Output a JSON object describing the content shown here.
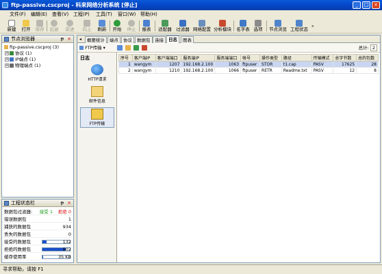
{
  "window": {
    "title": "ftp-passive.cscproj - 科来网络分析系统 [停止]"
  },
  "menu": [
    "文件(F)",
    "编辑(E)",
    "查看(V)",
    "工程(P)",
    "工具(T)",
    "窗口(W)",
    "帮助(H)"
  ],
  "toolbar": [
    {
      "label": "新建",
      "icon": "new-file-icon",
      "enabled": true
    },
    {
      "label": "打开",
      "icon": "open-folder-icon",
      "enabled": true
    },
    {
      "label": "保存",
      "icon": "save-icon",
      "enabled": false
    },
    {
      "label": "后退",
      "icon": "back-arrow-icon",
      "enabled": false
    },
    {
      "label": "前进",
      "icon": "forward-arrow-icon",
      "enabled": false
    },
    {
      "label": "向上",
      "icon": "up-icon",
      "enabled": false
    },
    {
      "label": "刷新",
      "icon": "refresh-icon",
      "enabled": true
    },
    {
      "label": "开始",
      "icon": "start-icon",
      "enabled": true
    },
    {
      "label": "停止",
      "icon": "stop-icon",
      "enabled": false
    },
    {
      "label": "报表",
      "icon": "report-icon",
      "enabled": true
    },
    {
      "label": "适配器",
      "icon": "adapter-icon",
      "enabled": true
    },
    {
      "label": "过滤器",
      "icon": "filter-icon",
      "enabled": true
    },
    {
      "label": "网络配置",
      "icon": "network-config-icon",
      "enabled": true
    },
    {
      "label": "分析模块",
      "icon": "analysis-module-icon",
      "enabled": true
    },
    {
      "label": "名字表",
      "icon": "name-table-icon",
      "enabled": true
    },
    {
      "label": "选项",
      "icon": "options-icon",
      "enabled": true
    },
    {
      "label": "节点浏览",
      "icon": "node-browser-icon",
      "enabled": true
    },
    {
      "label": "工程状态",
      "icon": "project-status-icon",
      "enabled": true
    }
  ],
  "node_panel": {
    "title": "节点浏览器",
    "root": "ftp-passive.cscproj (3)",
    "items": [
      "协议 (1)",
      "IP端点 (1)",
      "物理端点 (1)"
    ]
  },
  "status_panel": {
    "title": "工程状态栏",
    "filter_label": "数据包过滤器:",
    "accept_label": "接受",
    "accept_value": "1",
    "reject_label": "拒绝",
    "reject_value": "0",
    "rows": [
      {
        "label": "错误数据包",
        "value": "1"
      },
      {
        "label": "捕获的数据包",
        "value": "934"
      },
      {
        "label": "丢失的数据包",
        "value": "0"
      },
      {
        "label": "接受的数据包",
        "value": "132",
        "bar": 0.14
      },
      {
        "label": "拒绝的数据包",
        "value": "802",
        "bar": 0.86
      },
      {
        "label": "缓存使用率",
        "value": "35 KB",
        "bar": 0.02
      }
    ]
  },
  "tabs": [
    "概要统计",
    "端点",
    "协议",
    "数据包",
    "连接",
    "日志",
    "图表"
  ],
  "active_tab": 5,
  "subtoolbar": {
    "dropdown": "FTP传输",
    "total_label": "总计:",
    "total_value": "2"
  },
  "left_nav": {
    "title": "日志",
    "items": [
      {
        "label": "HTTP请求",
        "icon": "http-request-icon"
      },
      {
        "label": "邮件信息",
        "icon": "mail-info-icon"
      },
      {
        "label": "FTP传输",
        "icon": "ftp-transfer-icon"
      }
    ],
    "active": 2
  },
  "table": {
    "columns": [
      "序号",
      "客户端IP",
      "客户端端口",
      "服务端IP",
      "服务端端口",
      "帐号",
      "操作类型",
      "路径",
      "传输模式",
      "总字节数",
      "总的包数"
    ],
    "rows": [
      [
        "1",
        "wangym",
        "1207",
        "192.168.2.100",
        "1063",
        "ftpuser",
        "STOR",
        "t1.cap",
        "PASV",
        "17625",
        "28"
      ],
      [
        "2",
        "wangym",
        "1210",
        "192.168.2.100",
        "1066",
        "ftpuser",
        "RETR",
        "Readme.txt",
        "PASV",
        "12",
        "8"
      ]
    ]
  },
  "statusbar": {
    "text": "寻求帮助，请按 F1"
  }
}
